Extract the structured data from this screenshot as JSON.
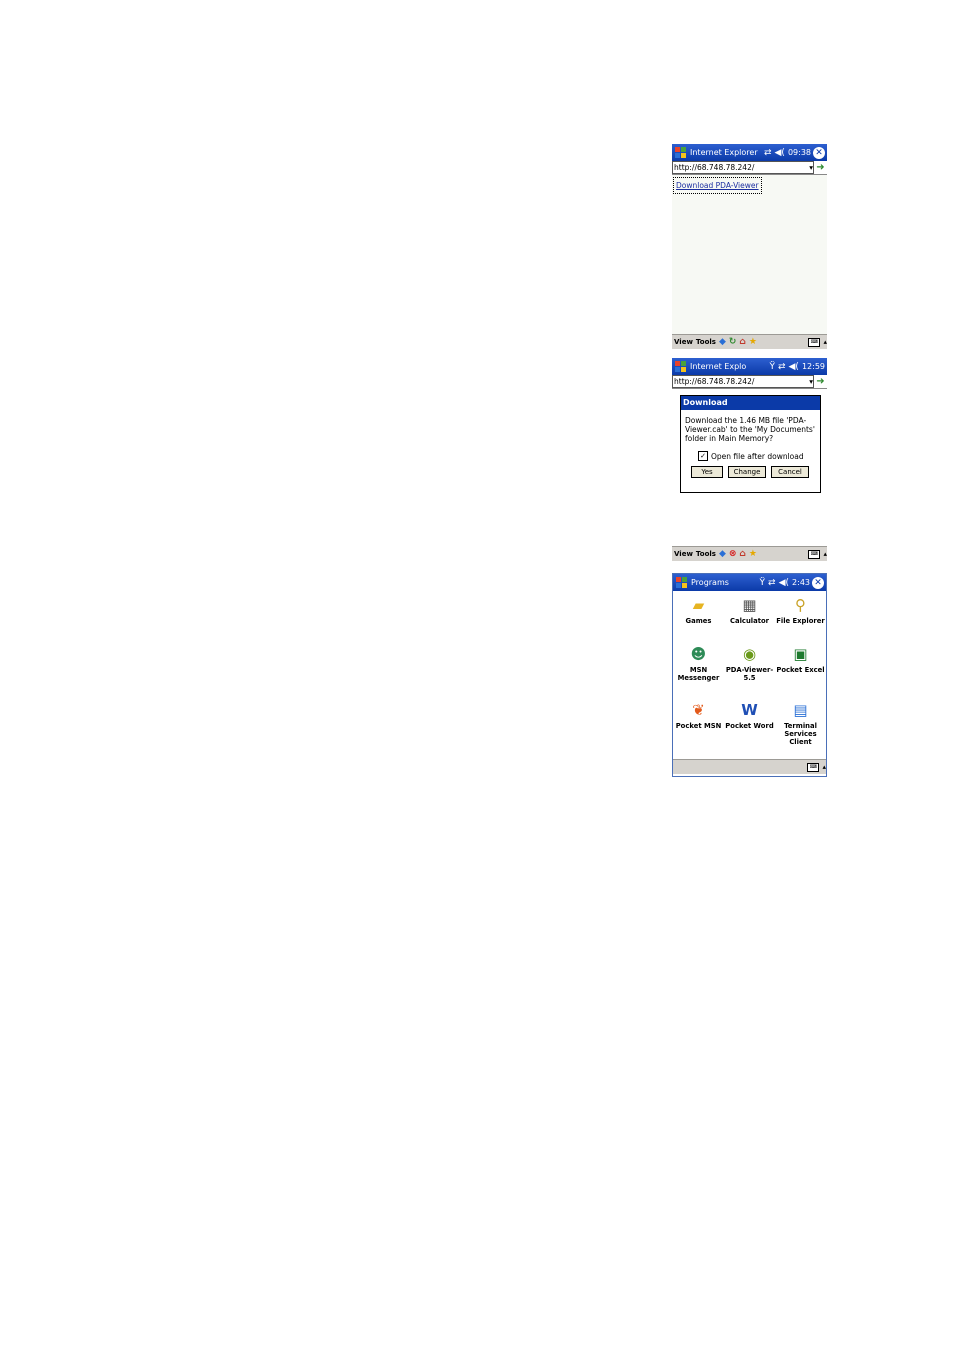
{
  "shot1": {
    "title": "Internet Explorer",
    "time": "09:38",
    "address": "http://68.748.78.242/",
    "link": "Download PDA-Viewer",
    "menu": [
      "View",
      "Tools"
    ]
  },
  "shot2": {
    "title": "Internet Explo",
    "time": "12:59",
    "address": "http://68.748.78.242/",
    "dialog": {
      "title": "Download",
      "message": "Download the 1.46 MB file 'PDA-Viewer.cab' to the 'My Documents' folder in Main Memory?",
      "checkbox_label": "Open file after download",
      "checked": true,
      "buttons": [
        "Yes",
        "Change",
        "Cancel"
      ]
    }
  },
  "shot3": {
    "menu": [
      "View",
      "Tools"
    ]
  },
  "shot4": {
    "title": "Programs",
    "time": "2:43",
    "apps": [
      {
        "label": "Games",
        "icon": "games-folder-icon"
      },
      {
        "label": "Calculator",
        "icon": "calculator-icon"
      },
      {
        "label": "File Explorer",
        "icon": "file-explorer-icon"
      },
      {
        "label": "MSN Messenger",
        "icon": "msn-messenger-icon"
      },
      {
        "label": "PDA-Viewer-5.5",
        "icon": "pda-viewer-icon"
      },
      {
        "label": "Pocket Excel",
        "icon": "excel-icon"
      },
      {
        "label": "Pocket MSN",
        "icon": "msn-butterfly-icon"
      },
      {
        "label": "Pocket Word",
        "icon": "word-icon"
      },
      {
        "label": "Terminal Services Client",
        "icon": "terminal-services-icon"
      }
    ]
  }
}
